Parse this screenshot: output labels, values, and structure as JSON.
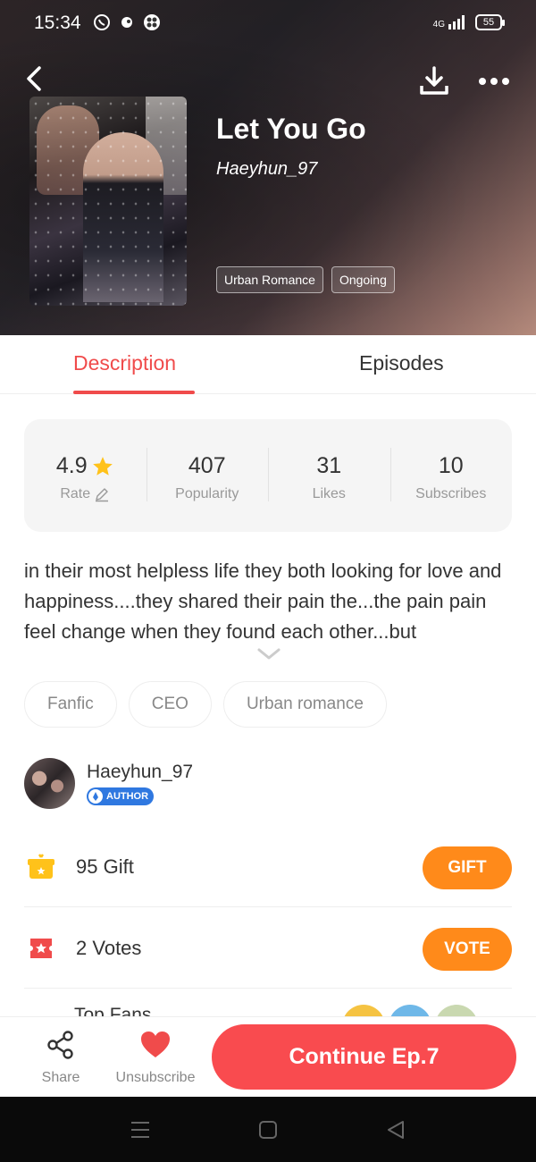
{
  "status_bar": {
    "time": "15:34",
    "network": "4G",
    "battery": "55"
  },
  "book": {
    "title": "Let You Go",
    "author": "Haeyhun_97",
    "tags": [
      "Urban Romance",
      "Ongoing"
    ]
  },
  "tabs": [
    {
      "label": "Description",
      "active": true
    },
    {
      "label": "Episodes",
      "active": false
    }
  ],
  "stats": [
    {
      "value": "4.9",
      "label": "Rate"
    },
    {
      "value": "407",
      "label": "Popularity"
    },
    {
      "value": "31",
      "label": "Likes"
    },
    {
      "value": "10",
      "label": "Subscribes"
    }
  ],
  "description": "in their most helpless life they both looking for love and happiness....they shared their pain the...the pain pain feel change when they found each other...but",
  "chips": [
    "Fanfic",
    "CEO",
    "Urban romance"
  ],
  "author_card": {
    "name": "Haeyhun_97",
    "badge": "AUTHOR"
  },
  "gift": {
    "count": "95",
    "label": "Gift",
    "button": "GIFT"
  },
  "votes": {
    "count": "2",
    "label": "Votes",
    "button": "VOTE"
  },
  "fans": {
    "label": "Top Fans"
  },
  "bottom": {
    "share_label": "Share",
    "unsubscribe_label": "Unsubscribe",
    "continue_label": "Continue Ep.7"
  },
  "colors": {
    "accent": "#f94b4f",
    "orange": "#ff8a1a",
    "gift_yellow": "#ffc21a"
  }
}
